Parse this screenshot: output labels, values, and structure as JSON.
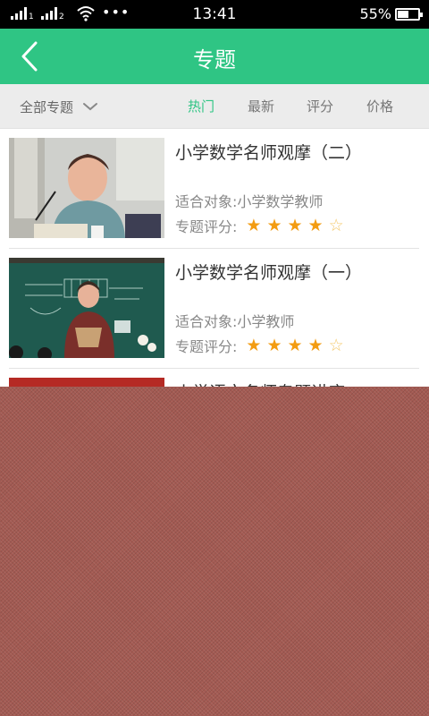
{
  "status_bar": {
    "time": "13:41",
    "battery_percent": "55%",
    "battery_level": 0.55,
    "sim1_label": "1",
    "sim2_label": "2",
    "more": "•••"
  },
  "header": {
    "title": "专题",
    "back_icon": "chevron-left-icon"
  },
  "filter": {
    "category_label": "全部专题",
    "sort_tabs": [
      {
        "label": "热门",
        "active": true
      },
      {
        "label": "最新",
        "active": false
      },
      {
        "label": "评分",
        "active": false
      },
      {
        "label": "价格",
        "active": false
      }
    ]
  },
  "items": [
    {
      "title": "小学数学名师观摩（二）",
      "audience_label": "适合对象:",
      "audience": "小学数学教师",
      "rating_label": "专题评分:",
      "rating": 4,
      "rating_max": 5
    },
    {
      "title": "小学数学名师观摩（一）",
      "audience_label": "适合对象:",
      "audience": "小学教师",
      "rating_label": "专题评分:",
      "rating": 4,
      "rating_max": 5
    },
    {
      "title": "小学语文名师专题讲座",
      "audience_label": "",
      "audience": "",
      "rating_label": "",
      "rating": 0,
      "rating_max": 5
    }
  ],
  "colors": {
    "accent": "#2fc584",
    "star": "#f39c12"
  }
}
